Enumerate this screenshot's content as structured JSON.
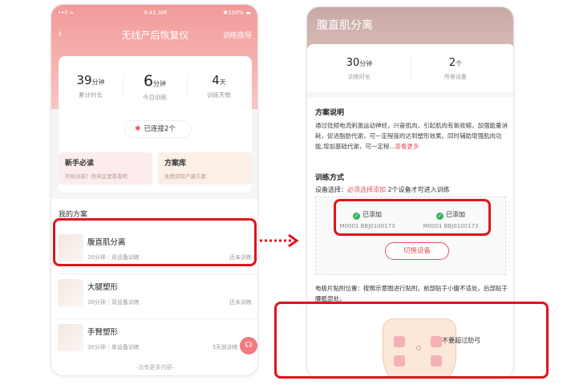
{
  "colors": {
    "accent": "#e2535f",
    "highlight": "#e0141c",
    "header": "#f19a9a",
    "success": "#34b45a"
  },
  "left": {
    "status": {
      "carrier": "••ll ≈",
      "time": "9:41 AM",
      "battery": "✱100% ▬"
    },
    "nav": {
      "back_icon": "chevron-left-icon",
      "title": "无线产后恢复仪",
      "guide": "训练指导"
    },
    "stats": [
      {
        "value": "39",
        "unit": "分钟",
        "label": "累计时长"
      },
      {
        "value": "6",
        "unit": "分钟",
        "label": "今日训练"
      },
      {
        "value": "4",
        "unit": "天",
        "label": "训练天数"
      }
    ],
    "connected": "已连接2个",
    "tiles": [
      {
        "title": "新手必读",
        "subtitle": "开始训练？快来这里看看吧"
      },
      {
        "title": "方案库",
        "subtitle": "免费获取产康方案"
      }
    ],
    "plans_header": "我的方案",
    "plans": [
      {
        "name": "腹直肌分离",
        "meta": "30分钟｜双设备训练",
        "state": "还未训练"
      },
      {
        "name": "大腿塑形",
        "meta": "30分钟｜双设备训练",
        "state": "还未训练"
      },
      {
        "name": "手臂塑形",
        "meta": "30分钟｜单设备训练",
        "state": "3天前训练"
      }
    ],
    "no_more": "–没有更多内容–",
    "fab_icon": "headset-icon"
  },
  "right": {
    "title": "腹直肌分离",
    "stats": [
      {
        "value": "30",
        "unit": "分钟",
        "label": "训练时长"
      },
      {
        "value": "2",
        "unit": "个",
        "label": "所需设备"
      }
    ],
    "desc_header": "方案说明",
    "desc_text": "通过低频电流刺激运动神经，兴奋肌肉，引起肌肉有氧收缩，加强能量消耗，促进脂肪代谢，可一定程度的达到塑形效果。同时辅助增强肌肉功能,增加基础代谢，可一定程...",
    "desc_more": "查看更多",
    "method_header": "训练方式",
    "select_prefix": "设备选择：",
    "select_must": "必须选择添加",
    "select_suffix": " 2个设备才可进入训练",
    "devices": [
      {
        "status": "已添加",
        "id": "M0001 BBJ0100173"
      },
      {
        "status": "已添加",
        "id": "M0001 BBJ0100173"
      }
    ],
    "switch_label": "切换设备",
    "position_text": "电极片贴附位置：按照示意图进行贴附。前部贴于小腹不适处，后部贴于腰骶部处。",
    "warning": "不要超过肋弓"
  }
}
